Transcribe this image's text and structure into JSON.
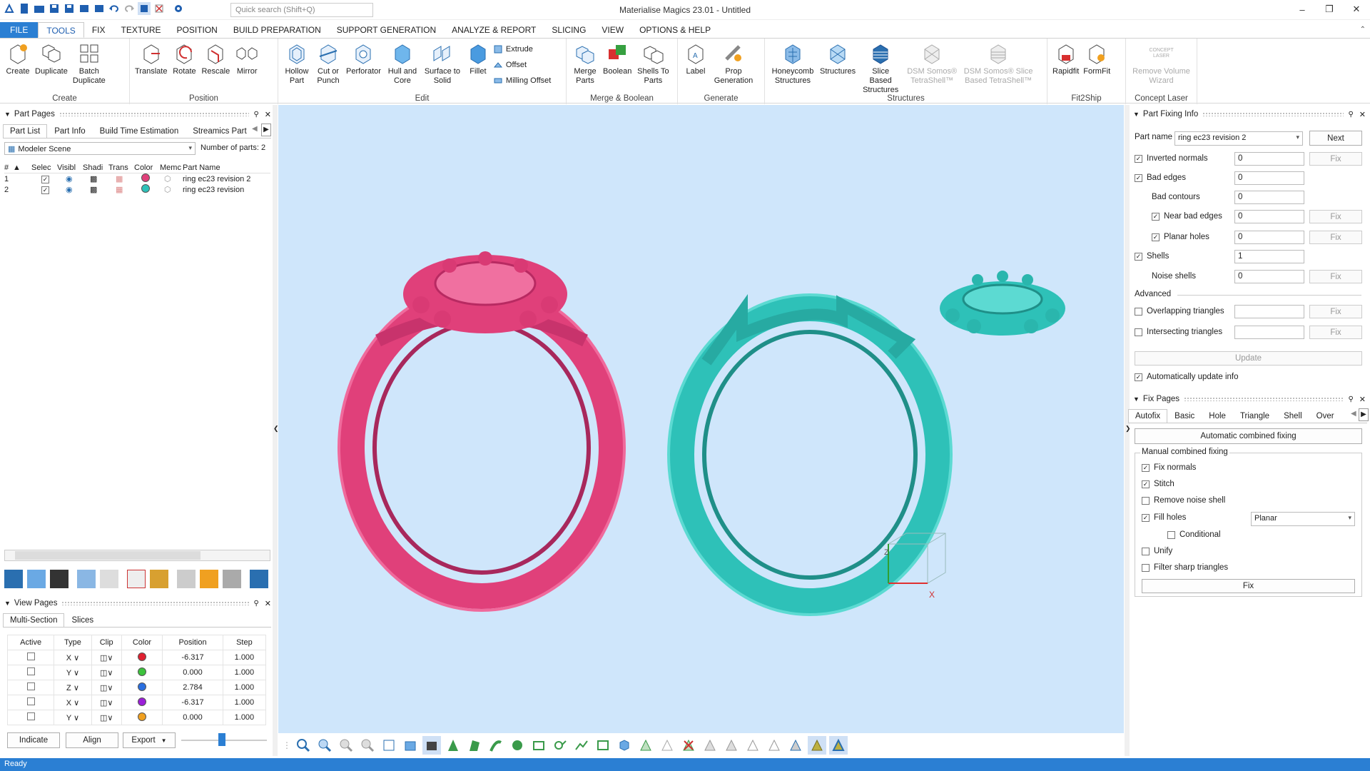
{
  "window": {
    "title": "Materialise Magics 23.01 - Untitled",
    "search_placeholder": "Quick search (Shift+Q)"
  },
  "ribbon_tabs": [
    "FILE",
    "TOOLS",
    "FIX",
    "TEXTURE",
    "POSITION",
    "BUILD PREPARATION",
    "SUPPORT GENERATION",
    "ANALYZE & REPORT",
    "SLICING",
    "VIEW",
    "OPTIONS & HELP"
  ],
  "ribbon": {
    "create": {
      "label": "Create",
      "buttons": [
        "Create",
        "Duplicate",
        "Batch Duplicate"
      ]
    },
    "position": {
      "label": "Position",
      "buttons": [
        "Translate",
        "Rotate",
        "Rescale",
        "Mirror"
      ]
    },
    "edit": {
      "label": "Edit",
      "buttons": [
        "Hollow Part",
        "Cut or Punch",
        "Perforator",
        "Hull and Core",
        "Surface to Solid",
        "Fillet"
      ],
      "small": [
        "Extrude",
        "Offset",
        "Milling Offset"
      ]
    },
    "merge": {
      "label": "Merge & Boolean",
      "buttons": [
        "Merge Parts",
        "Boolean",
        "Shells To Parts"
      ]
    },
    "generate": {
      "label": "Generate",
      "buttons": [
        "Label",
        "Prop Generation"
      ]
    },
    "structures": {
      "label": "Structures",
      "buttons": [
        "Honeycomb Structures",
        "Structures",
        "Slice Based Structures",
        "DSM Somos® TetraShell™",
        "DSM Somos® Slice Based TetraShell™"
      ]
    },
    "fit2ship": {
      "label": "Fit2Ship",
      "buttons": [
        "Rapidfit",
        "FormFit"
      ]
    },
    "concept": {
      "label": "Concept Laser",
      "buttons": [
        "Remove Volume Wizard"
      ],
      "logo": "CONCEPT LASER"
    }
  },
  "part_pages": {
    "title": "Part Pages",
    "tabs": [
      "Part List",
      "Part Info",
      "Build Time Estimation",
      "Streamics Part"
    ],
    "scene": "Modeler Scene",
    "num_parts_label": "Number of parts:",
    "num_parts": "2",
    "columns": [
      "#",
      "Selec",
      "Visibl",
      "Shadi",
      "Trans",
      "Color",
      "Memc",
      "Part Name"
    ],
    "rows": [
      {
        "num": "1",
        "name": "ring ec23 revision 2",
        "color": "#e0407a"
      },
      {
        "num": "2",
        "name": "ring ec23 revision",
        "color": "#2ec1b8"
      }
    ]
  },
  "view_pages": {
    "title": "View Pages",
    "tabs": [
      "Multi-Section",
      "Slices"
    ],
    "columns": [
      "Active",
      "Type",
      "Clip",
      "Color",
      "Position",
      "Step"
    ],
    "rows": [
      {
        "type": "X",
        "color": "#e02030",
        "position": "-6.317",
        "step": "1.000"
      },
      {
        "type": "Y",
        "color": "#3cc23c",
        "position": "0.000",
        "step": "1.000"
      },
      {
        "type": "Z",
        "color": "#2a6fe0",
        "position": "2.784",
        "step": "1.000"
      },
      {
        "type": "X",
        "color": "#9b1fd8",
        "position": "-6.317",
        "step": "1.000"
      },
      {
        "type": "Y",
        "color": "#f0a020",
        "position": "0.000",
        "step": "1.000"
      }
    ],
    "buttons": {
      "indicate": "Indicate",
      "align": "Align",
      "export": "Export"
    }
  },
  "part_fixing": {
    "title": "Part Fixing Info",
    "part_name_label": "Part name",
    "part_name": "ring ec23 revision 2",
    "next": "Next",
    "rows": [
      {
        "label": "Inverted normals",
        "value": "0",
        "checked": true,
        "fix": true
      },
      {
        "label": "Bad edges",
        "value": "0",
        "checked": true,
        "fix": false
      },
      {
        "label": "Bad contours",
        "value": "0",
        "checked": null,
        "fix": false
      },
      {
        "label": "Near bad edges",
        "value": "0",
        "checked": true,
        "fix": true
      },
      {
        "label": "Planar holes",
        "value": "0",
        "checked": true,
        "fix": true
      },
      {
        "label": "Shells",
        "value": "1",
        "checked": true,
        "fix": false
      },
      {
        "label": "Noise shells",
        "value": "0",
        "checked": null,
        "fix": true
      }
    ],
    "advanced_label": "Advanced",
    "advanced_rows": [
      {
        "label": "Overlapping triangles"
      },
      {
        "label": "Intersecting triangles"
      }
    ],
    "fix_label": "Fix",
    "update": "Update",
    "auto_update": "Automatically update info"
  },
  "fix_pages": {
    "title": "Fix Pages",
    "tabs": [
      "Autofix",
      "Basic",
      "Hole",
      "Triangle",
      "Shell",
      "Over"
    ],
    "auto_combined": "Automatic combined fixing",
    "manual_label": "Manual combined fixing",
    "options": [
      {
        "label": "Fix normals",
        "checked": true
      },
      {
        "label": "Stitch",
        "checked": true
      },
      {
        "label": "Remove noise shell",
        "checked": false
      },
      {
        "label": "Fill holes",
        "checked": true
      },
      {
        "label": "Conditional",
        "checked": false
      },
      {
        "label": "Unify",
        "checked": false
      },
      {
        "label": "Filter sharp triangles",
        "checked": false
      }
    ],
    "fill_mode": "Planar",
    "fix": "Fix"
  },
  "status": "Ready",
  "colors": {
    "accent": "#2b7fd3",
    "viewport": "#cfe6fb",
    "pink_part": "#e0407a",
    "teal_part": "#2ec1b8"
  },
  "axis_labels": {
    "x": "X",
    "z": "Z"
  }
}
